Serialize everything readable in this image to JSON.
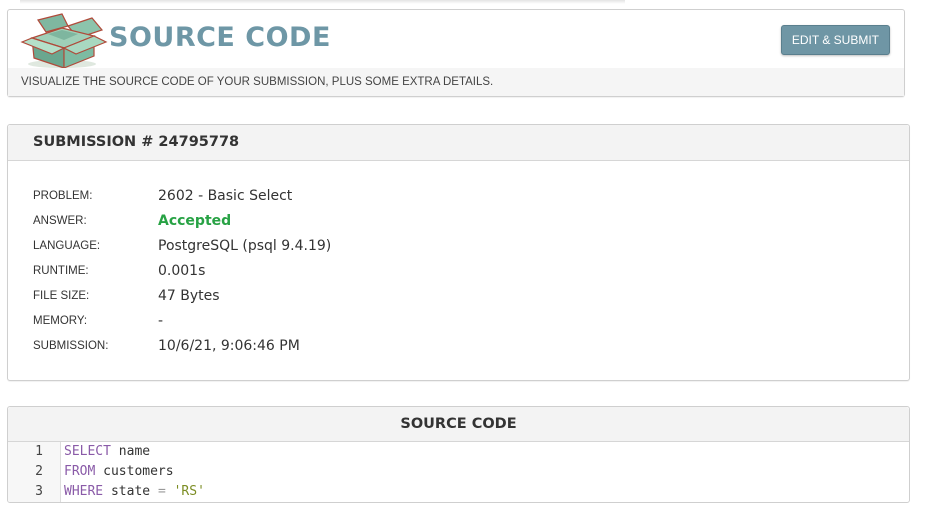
{
  "header": {
    "title": "SOURCE CODE",
    "subtitle": "VISUALIZE THE SOURCE CODE OF YOUR SUBMISSION, PLUS SOME EXTRA DETAILS.",
    "edit_submit_label": "EDIT & SUBMIT",
    "logo_icon": "open-box-icon"
  },
  "submission": {
    "title": "SUBMISSION # 24795778",
    "rows": [
      {
        "label": "PROBLEM:",
        "value": "2602 - Basic Select"
      },
      {
        "label": "ANSWER:",
        "value": "Accepted"
      },
      {
        "label": "LANGUAGE:",
        "value": "PostgreSQL (psql 9.4.19)"
      },
      {
        "label": "RUNTIME:",
        "value": "0.001s"
      },
      {
        "label": "FILE SIZE:",
        "value": "47 Bytes"
      },
      {
        "label": "MEMORY:",
        "value": "-"
      },
      {
        "label": "SUBMISSION:",
        "value": "10/6/21, 9:06:46 PM"
      }
    ]
  },
  "source_code": {
    "title": "SOURCE CODE",
    "lines": [
      {
        "number": "1",
        "keyword": "SELECT",
        "rest": " name"
      },
      {
        "number": "2",
        "keyword": "FROM",
        "rest": " customers"
      },
      {
        "number": "3",
        "keyword": "WHERE",
        "rest": " state ",
        "operator": "=",
        "string": "'RS'"
      }
    ]
  },
  "colors": {
    "accent": "#6e97a6",
    "button": "#6f96a5",
    "accepted": "#27a244",
    "keyword": "#8a5ba8",
    "string": "#7c8d24"
  }
}
